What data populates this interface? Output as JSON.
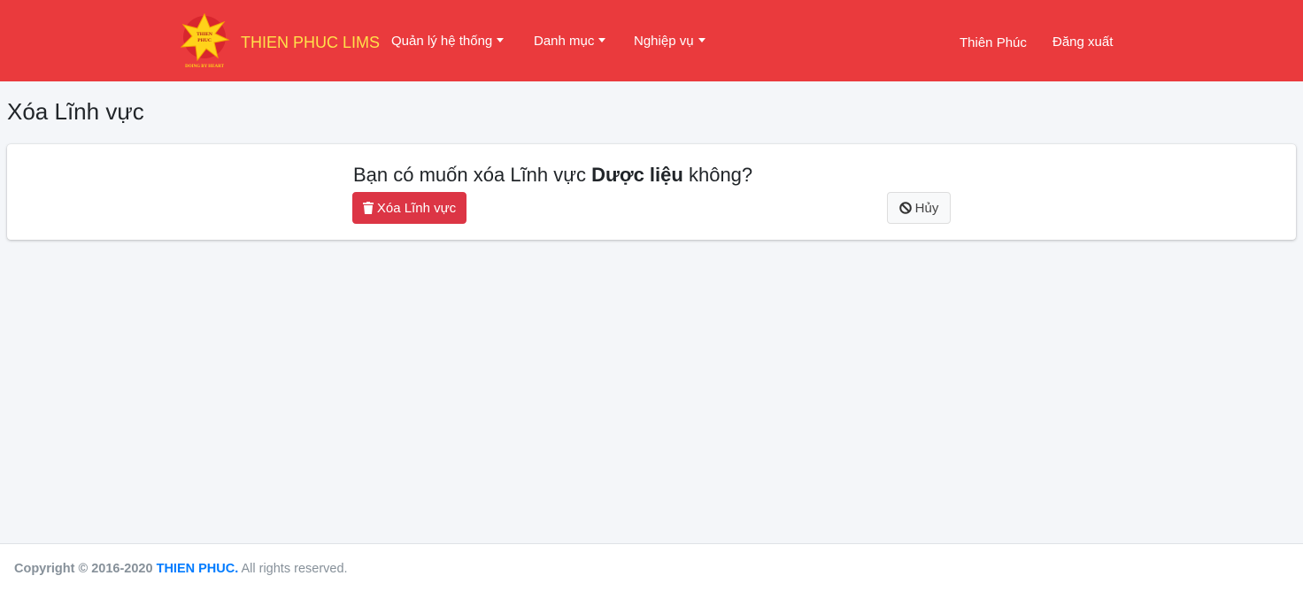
{
  "header": {
    "logo_text_top": "THIEN",
    "logo_text_bottom": "PHUC",
    "logo_tagline": "DOING BY HEART",
    "brand_name": "THIEN PHUC LIMS",
    "menu": [
      {
        "label": "Quản lý hệ thống",
        "has_dropdown": true
      },
      {
        "label": "Danh mục",
        "has_dropdown": true
      },
      {
        "label": "Nghiệp vụ",
        "has_dropdown": true
      }
    ],
    "user_name": "Thiên Phúc",
    "logout_label": "Đăng xuất"
  },
  "page": {
    "title": "Xóa Lĩnh vực",
    "question_prefix": "Bạn có muốn xóa Lĩnh vực",
    "item_name": "Dược liệu",
    "question_suffix": "không?",
    "delete_button_label": "Xóa Lĩnh vực",
    "cancel_button_label": "Hủy"
  },
  "footer": {
    "copyright": "Copyright © 2016-2020",
    "company": "THIEN PHUC.",
    "rights": "All rights reserved."
  },
  "colors": {
    "navbar": "#ea3a3d",
    "brand": "#ffe14a",
    "danger": "#dc3545",
    "link": "#007bff"
  },
  "icons": {
    "delete_button": "trash-icon",
    "cancel_button": "ban-icon",
    "dropdown": "caret-down-icon"
  }
}
